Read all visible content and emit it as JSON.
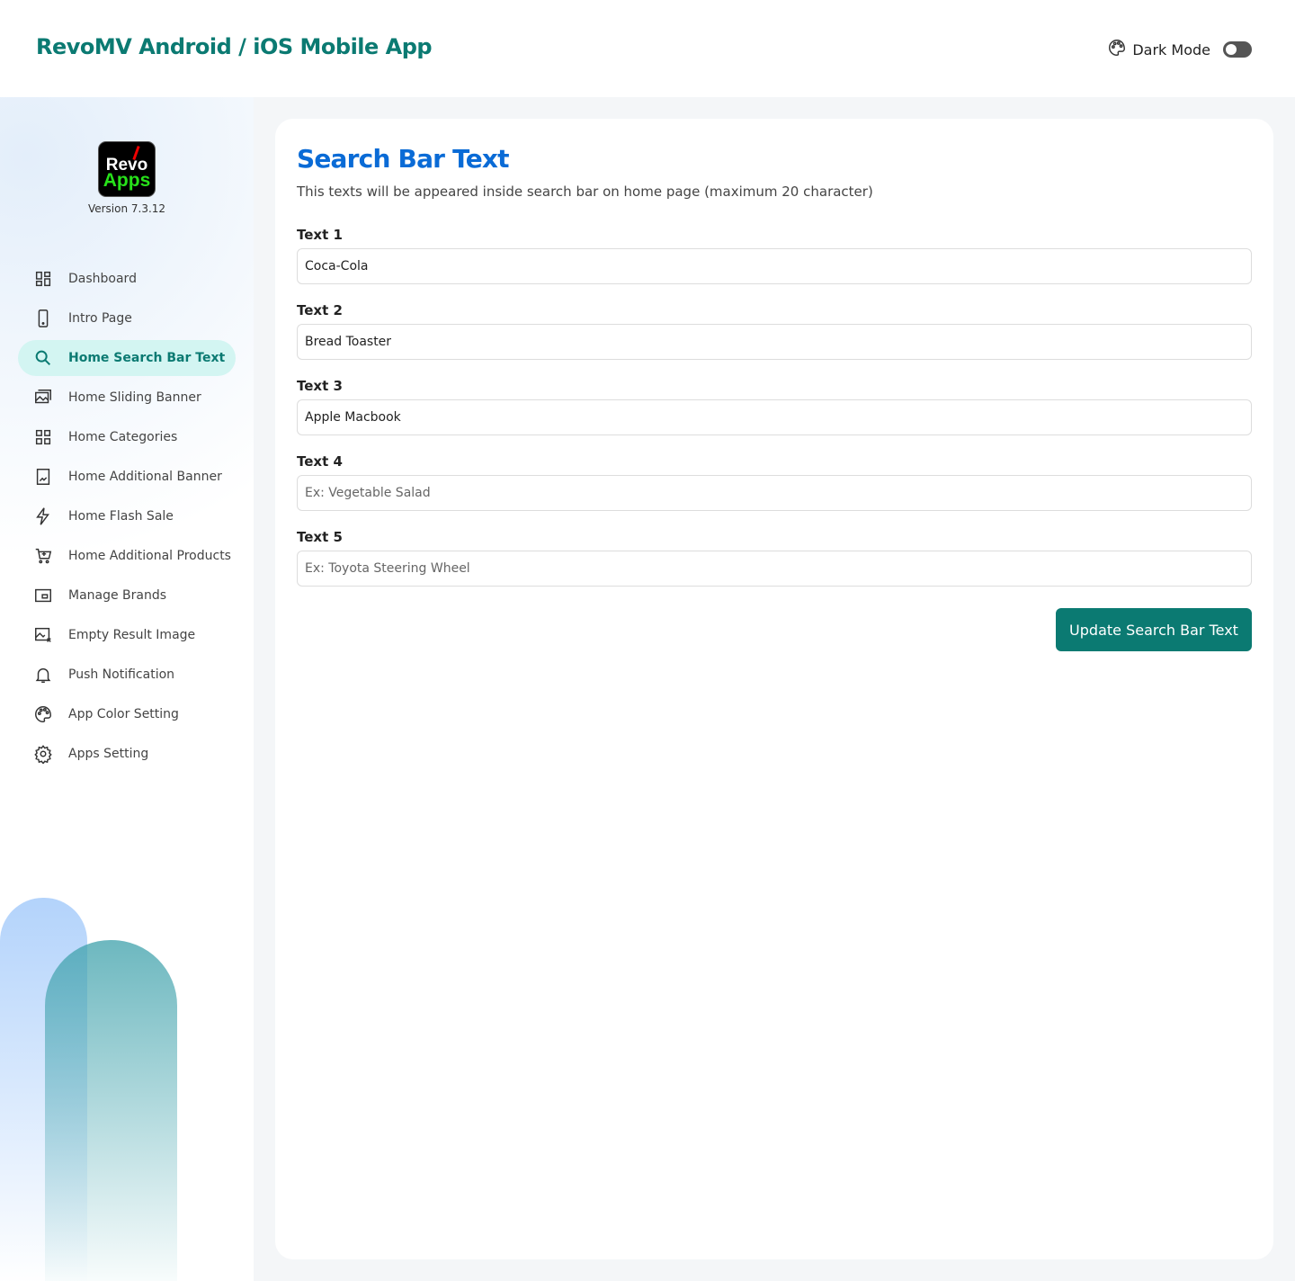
{
  "header": {
    "title": "RevoMV Android / iOS Mobile App",
    "dark_mode_label": "Dark Mode",
    "dark_mode_on": false
  },
  "sidebar": {
    "logo_text": [
      "Revo",
      "Apps"
    ],
    "version": "Version 7.3.12",
    "items": [
      {
        "label": "Dashboard",
        "icon": "dashboard-icon"
      },
      {
        "label": "Intro Page",
        "icon": "phone-icon"
      },
      {
        "label": "Home Search Bar Text",
        "icon": "search-icon",
        "active": true
      },
      {
        "label": "Home Sliding Banner",
        "icon": "images-icon"
      },
      {
        "label": "Home Categories",
        "icon": "grid-icon"
      },
      {
        "label": "Home Additional Banner",
        "icon": "image-icon"
      },
      {
        "label": "Home Flash Sale",
        "icon": "flash-icon"
      },
      {
        "label": "Home Additional Products",
        "icon": "cart-add-icon"
      },
      {
        "label": "Manage Brands",
        "icon": "brand-icon"
      },
      {
        "label": "Empty Result Image",
        "icon": "image-x-icon"
      },
      {
        "label": "Push Notification",
        "icon": "bell-icon"
      },
      {
        "label": "App Color Setting",
        "icon": "palette-icon"
      },
      {
        "label": "Apps Setting",
        "icon": "gear-icon"
      }
    ]
  },
  "main": {
    "title": "Search Bar Text",
    "description": "This texts will be appeared inside search bar on home page (maximum 20 character)",
    "fields": [
      {
        "label": "Text 1",
        "value": "Coca-Cola",
        "placeholder": ""
      },
      {
        "label": "Text 2",
        "value": "Bread Toaster",
        "placeholder": ""
      },
      {
        "label": "Text 3",
        "value": "Apple Macbook",
        "placeholder": ""
      },
      {
        "label": "Text 4",
        "value": "",
        "placeholder": "Ex: Vegetable Salad"
      },
      {
        "label": "Text 5",
        "value": "",
        "placeholder": "Ex: Toyota Steering Wheel"
      }
    ],
    "submit_label": "Update Search Bar Text"
  },
  "colors": {
    "brand": "#0b7a72",
    "title": "#0a6bd6",
    "active_bg": "#d3f5f2"
  }
}
